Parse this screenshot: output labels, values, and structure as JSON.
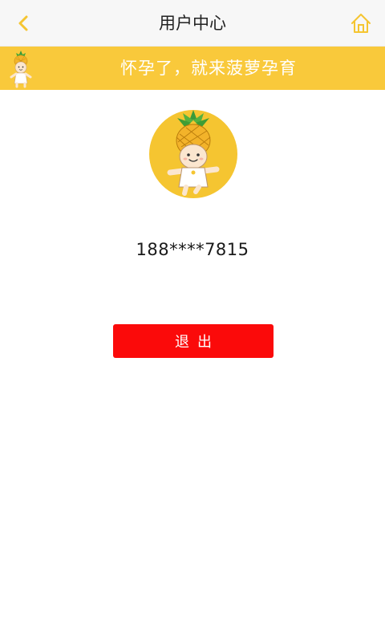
{
  "header": {
    "title": "用户中心",
    "back_icon": "chevron-left-icon",
    "home_icon": "home-icon",
    "accent_color": "#f5c531"
  },
  "banner": {
    "text": "怀孕了，就来菠萝孕育",
    "background_color": "#f9c93b",
    "mascot_icon": "pineapple-mascot-icon"
  },
  "profile": {
    "avatar_icon": "pineapple-mascot-avatar",
    "phone": "188****7815"
  },
  "actions": {
    "logout_label": "退出",
    "logout_color": "#fb0a0a"
  }
}
